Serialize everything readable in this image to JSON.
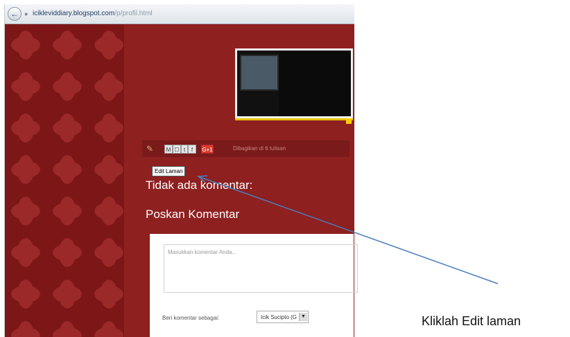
{
  "browser": {
    "url_host": "icikleviddiary.blogspot.com",
    "url_path": "/p/profil.html"
  },
  "sharebar": {
    "buttons": [
      "M",
      "☐",
      "t",
      "f",
      "G+1"
    ],
    "shared_text": "Dibagikan di 6 tulisan"
  },
  "edit_button": {
    "label": "Edit Laman"
  },
  "comments": {
    "none_text": "Tidak ada komentar:",
    "heading": "Poskan Komentar",
    "placeholder": "Masukkan komentar Anda...",
    "identity_label": "Beri komentar sebagai:",
    "identity_value": "Icik Sucipto (G"
  },
  "annotation": {
    "caption": "Kliklah Edit laman",
    "arrow_color": "#4a7ebb"
  },
  "icons": {
    "back": "back-arrow-icon",
    "site": "globe-icon",
    "pencil": "pencil-icon"
  }
}
